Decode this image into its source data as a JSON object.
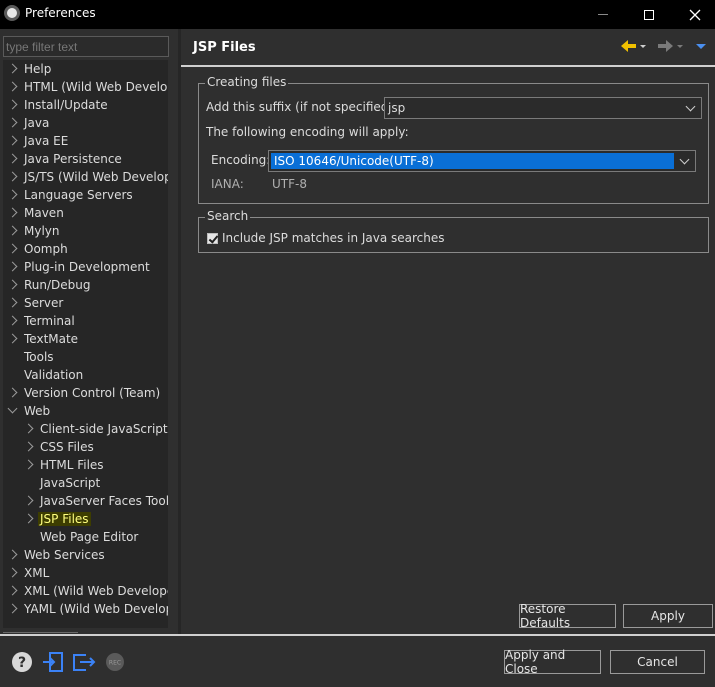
{
  "window": {
    "title": "Preferences",
    "controls": [
      "minimize",
      "maximize",
      "close"
    ]
  },
  "filter": {
    "placeholder": "type filter text",
    "value": ""
  },
  "tree": {
    "items": [
      {
        "label": "Help",
        "expandable": true,
        "level": 0
      },
      {
        "label": "HTML (Wild Web Develop",
        "expandable": true,
        "level": 0
      },
      {
        "label": "Install/Update",
        "expandable": true,
        "level": 0
      },
      {
        "label": "Java",
        "expandable": true,
        "level": 0
      },
      {
        "label": "Java EE",
        "expandable": true,
        "level": 0
      },
      {
        "label": "Java Persistence",
        "expandable": true,
        "level": 0
      },
      {
        "label": "JS/TS (Wild Web Develop",
        "expandable": true,
        "level": 0
      },
      {
        "label": "Language Servers",
        "expandable": true,
        "level": 0
      },
      {
        "label": "Maven",
        "expandable": true,
        "level": 0
      },
      {
        "label": "Mylyn",
        "expandable": true,
        "level": 0
      },
      {
        "label": "Oomph",
        "expandable": true,
        "level": 0
      },
      {
        "label": "Plug-in Development",
        "expandable": true,
        "level": 0
      },
      {
        "label": "Run/Debug",
        "expandable": true,
        "level": 0
      },
      {
        "label": "Server",
        "expandable": true,
        "level": 0
      },
      {
        "label": "Terminal",
        "expandable": true,
        "level": 0
      },
      {
        "label": "TextMate",
        "expandable": true,
        "level": 0
      },
      {
        "label": "Tools",
        "expandable": false,
        "level": 0
      },
      {
        "label": "Validation",
        "expandable": false,
        "level": 0
      },
      {
        "label": "Version Control (Team)",
        "expandable": true,
        "level": 0
      },
      {
        "label": "Web",
        "expandable": true,
        "expanded": true,
        "level": 0
      },
      {
        "label": "Client-side JavaScript",
        "expandable": true,
        "level": 1
      },
      {
        "label": "CSS Files",
        "expandable": true,
        "level": 1
      },
      {
        "label": "HTML Files",
        "expandable": true,
        "level": 1
      },
      {
        "label": "JavaScript",
        "expandable": false,
        "level": 1
      },
      {
        "label": "JavaServer Faces Tools",
        "expandable": true,
        "level": 1
      },
      {
        "label": "JSP Files",
        "expandable": true,
        "level": 1,
        "selected": true
      },
      {
        "label": "Web Page Editor",
        "expandable": false,
        "level": 1
      },
      {
        "label": "Web Services",
        "expandable": true,
        "level": 0
      },
      {
        "label": "XML",
        "expandable": true,
        "level": 0
      },
      {
        "label": "XML (Wild Web Develope",
        "expandable": true,
        "level": 0
      },
      {
        "label": "YAML (Wild Web Develop",
        "expandable": true,
        "level": 0
      }
    ]
  },
  "page": {
    "title": "JSP Files",
    "creating_files": {
      "legend": "Creating files",
      "suffix_label": "Add this suffix (if not specified):",
      "suffix_value": "jsp",
      "encoding_note": "The following encoding will apply:",
      "encoding_label": "Encoding:",
      "encoding_value": "ISO 10646/Unicode(UTF-8)",
      "iana_label": "IANA:",
      "iana_value": "UTF-8"
    },
    "search": {
      "legend": "Search",
      "checkbox_label": "Include JSP matches in Java searches",
      "checked": true
    },
    "restore_defaults": "Restore Defaults",
    "apply": "Apply"
  },
  "footer": {
    "apply_and_close": "Apply and Close",
    "cancel": "Cancel",
    "icons": [
      "help-icon",
      "import-icon",
      "export-icon",
      "record-icon"
    ],
    "record_label": "REC"
  },
  "colors": {
    "selection_bg": "#0a6fd6",
    "tree_selected_bg": "#3d3d00",
    "tree_selected_fg": "#ffff80",
    "back_arrow": "#f0c000",
    "footer_icon_blue": "#3b82f6"
  }
}
